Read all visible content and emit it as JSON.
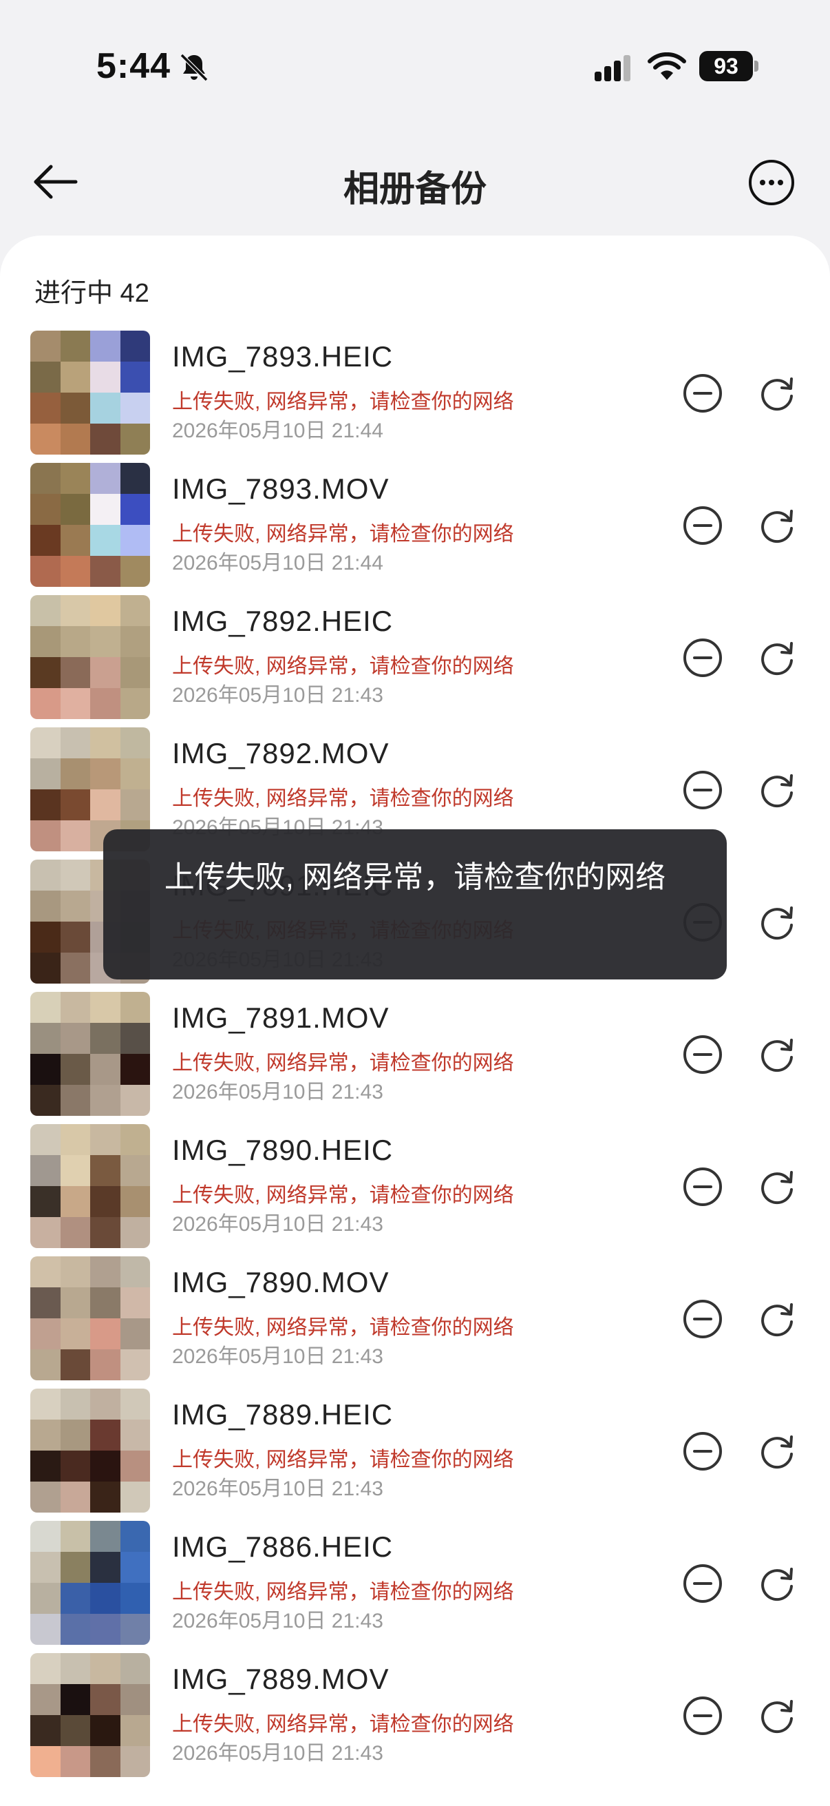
{
  "status": {
    "time": "5:44",
    "battery": "93"
  },
  "nav": {
    "title": "相册备份"
  },
  "section": {
    "label": "进行中 42"
  },
  "toast": {
    "message": "上传失败, 网络异常，请检查你的网络"
  },
  "items": [
    {
      "name": "IMG_7893.HEIC",
      "error": "上传失败, 网络异常，请检查你的网络",
      "time": "2026年05月10日 21:44"
    },
    {
      "name": "IMG_7893.MOV",
      "error": "上传失败, 网络异常，请检查你的网络",
      "time": "2026年05月10日 21:44"
    },
    {
      "name": "IMG_7892.HEIC",
      "error": "上传失败, 网络异常，请检查你的网络",
      "time": "2026年05月10日 21:43"
    },
    {
      "name": "IMG_7892.MOV",
      "error": "上传失败, 网络异常，请检查你的网络",
      "time": "2026年05月10日 21:43"
    },
    {
      "name": "IMG_7891.HEIC",
      "error": "上传失败, 网络异常，请检查你的网络",
      "time": "2026年05月10日 21:43"
    },
    {
      "name": "IMG_7891.MOV",
      "error": "上传失败, 网络异常，请检查你的网络",
      "time": "2026年05月10日 21:43"
    },
    {
      "name": "IMG_7890.HEIC",
      "error": "上传失败, 网络异常，请检查你的网络",
      "time": "2026年05月10日 21:43"
    },
    {
      "name": "IMG_7890.MOV",
      "error": "上传失败, 网络异常，请检查你的网络",
      "time": "2026年05月10日 21:43"
    },
    {
      "name": "IMG_7889.HEIC",
      "error": "上传失败, 网络异常，请检查你的网络",
      "time": "2026年05月10日 21:43"
    },
    {
      "name": "IMG_7886.HEIC",
      "error": "上传失败, 网络异常，请检查你的网络",
      "time": "2026年05月10日 21:43"
    },
    {
      "name": "IMG_7889.MOV",
      "error": "上传失败, 网络异常，请检查你的网络",
      "time": "2026年05月10日 21:43"
    }
  ],
  "thumb_palettes": [
    [
      "#a58c6c",
      "#8a7a52",
      "#9aa0d8",
      "#2f3a7a",
      "#7a6a48",
      "#b9a27a",
      "#e8dce6",
      "#3b4fb0",
      "#96603e",
      "#7c5a38",
      "#a6d2e0",
      "#c8d0f0",
      "#c98a60",
      "#b27a50",
      "#6f4a3a",
      "#8f7f55"
    ],
    [
      "#8a7550",
      "#9a8458",
      "#b0b0d8",
      "#2a3044",
      "#8a6a44",
      "#7a6a40",
      "#f4f0f4",
      "#3c4ec0",
      "#6a3a22",
      "#9a7a52",
      "#a8d8e4",
      "#b0bcf4",
      "#b06a50",
      "#c47a58",
      "#8a5a48",
      "#a08a60"
    ],
    [
      "#c8c0a8",
      "#d8c8a8",
      "#e0c8a0",
      "#c0b090",
      "#a89878",
      "#b8a888",
      "#c0b090",
      "#b0a080",
      "#5a3a22",
      "#8a6a58",
      "#caa090",
      "#a89878",
      "#d89a88",
      "#e0b0a0",
      "#c09080",
      "#b8a888"
    ],
    [
      "#d8d0c0",
      "#c8c0b0",
      "#d0c0a0",
      "#c0b8a0",
      "#b8b0a0",
      "#a89070",
      "#b89878",
      "#c0b090",
      "#5a3420",
      "#7a4a30",
      "#e0b8a0",
      "#b8a890",
      "#c09080",
      "#d8b0a0",
      "#c0a890",
      "#b0a080"
    ],
    [
      "#c8c0b0",
      "#d0c8b8",
      "#c8b8a0",
      "#b8b0a0",
      "#a89880",
      "#b8a890",
      "#c0b0a0",
      "#a09080",
      "#4a2a18",
      "#6a4a38",
      "#b0a098",
      "#908070",
      "#3a2418",
      "#8a7060",
      "#b8a8a0",
      "#a89888"
    ],
    [
      "#d8d0b8",
      "#c8b8a0",
      "#d8c8a8",
      "#c0b090",
      "#9a9080",
      "#a89888",
      "#7a7060",
      "#585048",
      "#1a1010",
      "#6a5a48",
      "#a89888",
      "#2a1410",
      "#3a2a20",
      "#8a7868",
      "#b0a090",
      "#c8b8a8"
    ],
    [
      "#d0c8b8",
      "#d8c8a8",
      "#c8b8a0",
      "#c0b090",
      "#a09890",
      "#e0d0b0",
      "#7a5a40",
      "#b8a890",
      "#3a3028",
      "#c8a888",
      "#5a3a28",
      "#a89070",
      "#c8b0a0",
      "#b09080",
      "#6a4a38",
      "#c0b0a0"
    ],
    [
      "#d0c0a8",
      "#c8b8a0",
      "#b0a090",
      "#c0b8a8",
      "#6a5a50",
      "#b8a890",
      "#8a7a68",
      "#d0b8a8",
      "#c0a090",
      "#c8b098",
      "#d89a88",
      "#a89888",
      "#b8a890",
      "#6a4a38",
      "#c09080",
      "#d0c0b0"
    ],
    [
      "#d8d0c0",
      "#c8c0b0",
      "#c0b0a0",
      "#d0c8b8",
      "#b8a890",
      "#a89880",
      "#6a3a30",
      "#c8b8a8",
      "#2a1a14",
      "#4a2a20",
      "#2a1410",
      "#b89080",
      "#b0a090",
      "#c8a898",
      "#3a2418",
      "#d0c8b8"
    ],
    [
      "#d8d8d0",
      "#c8c0a8",
      "#7a8890",
      "#3a68b0",
      "#c8c0b0",
      "#8a8060",
      "#2a3040",
      "#4070c0",
      "#b8b0a0",
      "#3a60a8",
      "#2a50a0",
      "#3060b0",
      "#c8c8d0",
      "#5a70a8",
      "#6070a8",
      "#7080a8"
    ],
    [
      "#d8d0c0",
      "#c8c0b0",
      "#c8b8a0",
      "#b8b0a0",
      "#a89888",
      "#1a1010",
      "#7a5848",
      "#a09080",
      "#3a2a20",
      "#5a4a38",
      "#2a1810",
      "#b8a890",
      "#f0b090",
      "#c89888",
      "#8a6a58",
      "#c0b0a0"
    ]
  ]
}
